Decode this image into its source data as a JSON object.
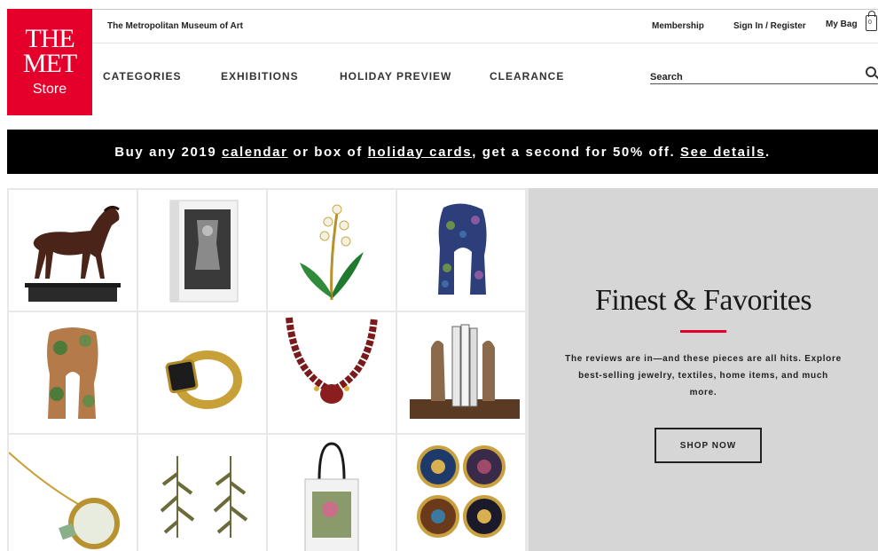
{
  "logo": {
    "line1": "THE",
    "line2": "MET",
    "line3": "Store"
  },
  "header": {
    "org_name": "The Metropolitan Museum of Art",
    "membership": "Membership",
    "sign_in": "Sign In / Register",
    "bag": "My Bag",
    "bag_count": "0"
  },
  "nav": [
    "CATEGORIES",
    "EXHIBITIONS",
    "HOLIDAY PREVIEW",
    "CLEARANCE"
  ],
  "search": {
    "placeholder": "Search"
  },
  "promo": {
    "t1": "Buy any 2019 ",
    "link1": "calendar",
    "t2": " or box of ",
    "link2": "holiday cards",
    "t3": ", get a second for 50% off. ",
    "link3": "See details",
    "t4": "."
  },
  "feature": {
    "title": "Finest & Favorites",
    "desc": "The reviews are in—and these pieces are all hits. Explore best-selling jewelry, textiles, home items, and much more.",
    "button": "SHOP NOW",
    "accent": "#e4002b"
  },
  "products": [
    "horse-sculpture",
    "art-book",
    "lily-of-the-valley-pin",
    "floral-scarf",
    "camouflage-scarf",
    "signet-ring",
    "bead-necklace",
    "figure-bookends",
    "magnifier-pendant",
    "branch-earrings",
    "tote-bag",
    "plate-set"
  ]
}
